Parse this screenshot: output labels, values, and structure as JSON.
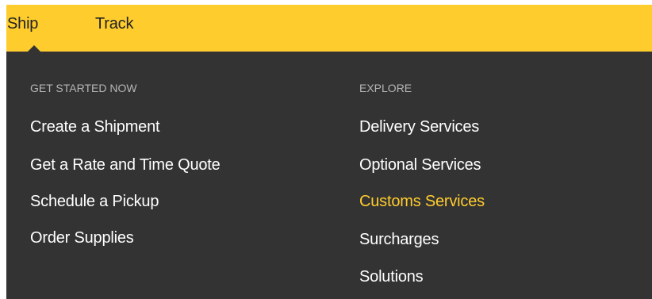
{
  "topbar": {
    "items": [
      {
        "label": "Ship"
      },
      {
        "label": "Track"
      }
    ]
  },
  "dropdown": {
    "left": {
      "heading": "GET STARTED NOW",
      "links": [
        {
          "label": "Create a Shipment"
        },
        {
          "label": "Get a Rate and Time Quote"
        },
        {
          "label": "Schedule a Pickup"
        },
        {
          "label": "Order Supplies"
        }
      ]
    },
    "right": {
      "heading": "EXPLORE",
      "links": [
        {
          "label": "Delivery Services"
        },
        {
          "label": "Optional Services"
        },
        {
          "label": "Customs Services",
          "state": "hovered"
        },
        {
          "label": "Surcharges"
        },
        {
          "label": "Solutions"
        }
      ]
    }
  },
  "colors": {
    "topbar_bg": "#ffcc2e",
    "dropdown_bg": "#333333",
    "link": "#ffffff",
    "link_active": "#ffcc2e",
    "heading": "#b5b5b5"
  }
}
